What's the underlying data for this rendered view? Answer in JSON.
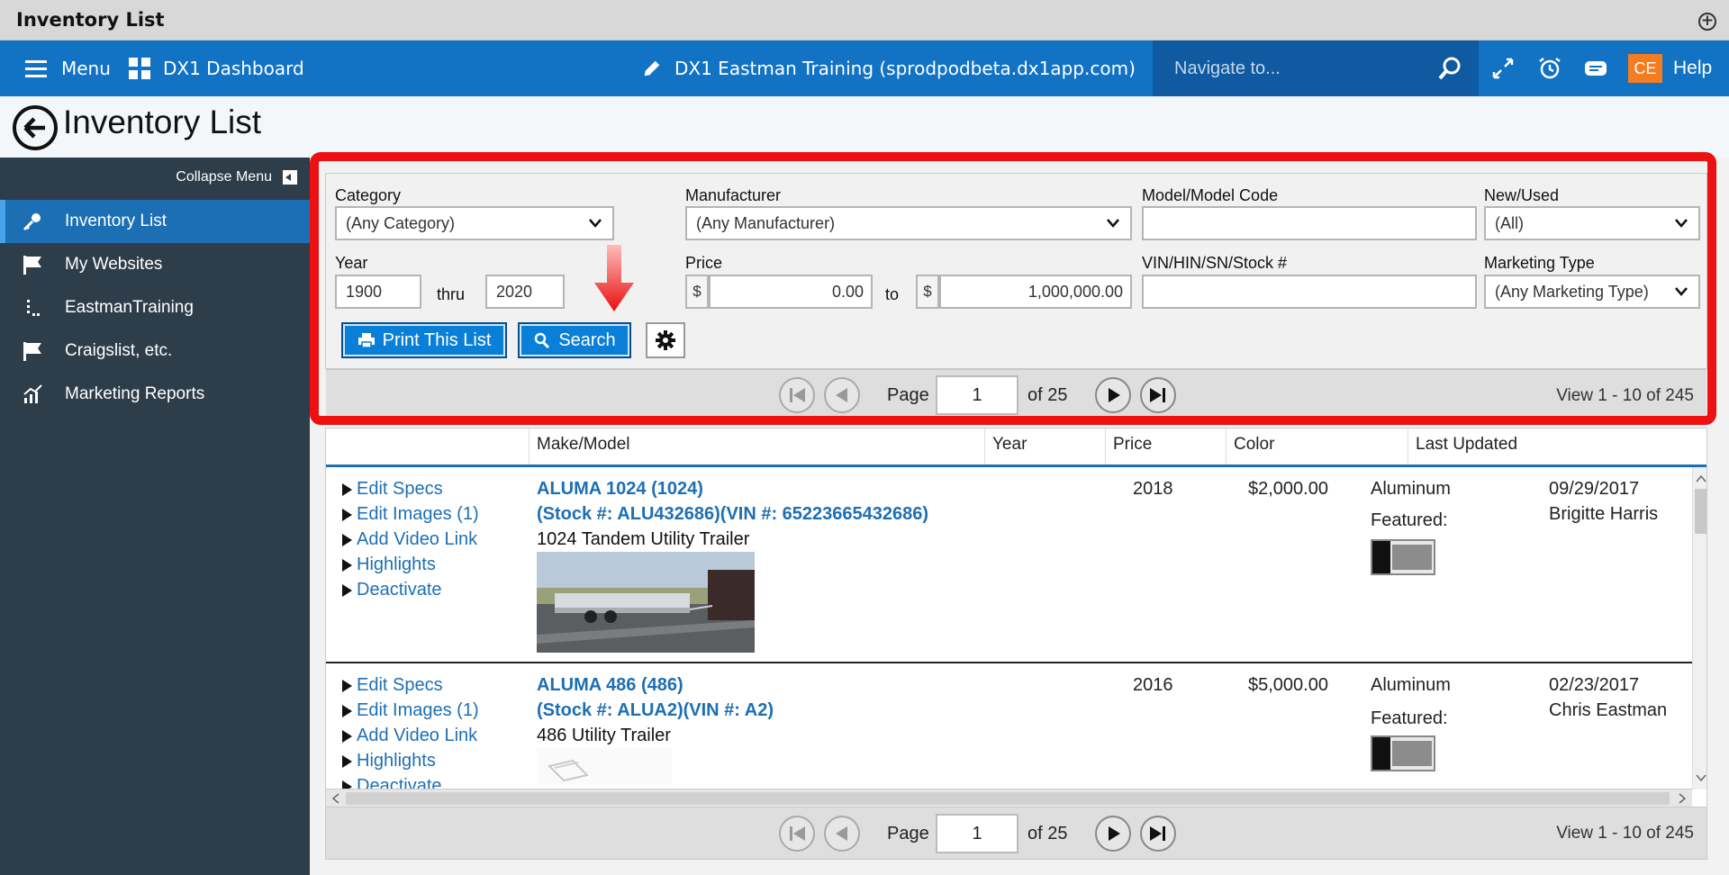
{
  "window": {
    "title": "Inventory List"
  },
  "topbar": {
    "menu_label": "Menu",
    "dashboard_label": "DX1 Dashboard",
    "site_label": "DX1 Eastman Training (sprodpodbeta.dx1app.com)",
    "navigate_placeholder": "Navigate to...",
    "avatar_initials": "CE",
    "help_label": "Help",
    "accent_color": "#1272c4"
  },
  "page": {
    "title": "Inventory List"
  },
  "sidebar": {
    "collapse_label": "Collapse Menu",
    "items": [
      {
        "label": "Inventory List",
        "icon": "key-icon",
        "active": true
      },
      {
        "label": "My Websites",
        "icon": "flag-icon"
      },
      {
        "label": "EastmanTraining",
        "icon": "dots-icon"
      },
      {
        "label": "Craigslist, etc.",
        "icon": "flag-icon"
      },
      {
        "label": "Marketing Reports",
        "icon": "chart-icon"
      }
    ]
  },
  "filters": {
    "category_label": "Category",
    "category_value": "(Any Category)",
    "manufacturer_label": "Manufacturer",
    "manufacturer_value": "(Any Manufacturer)",
    "model_label": "Model/Model Code",
    "model_value": "",
    "newused_label": "New/Used",
    "newused_value": "(All)",
    "year_label": "Year",
    "year_from": "1900",
    "year_thru_label": "thru",
    "year_to": "2020",
    "price_label": "Price",
    "currency_symbol": "$",
    "price_from": "0.00",
    "price_to_label": "to",
    "price_to": "1,000,000.00",
    "vin_label": "VIN/HIN/SN/Stock #",
    "vin_value": "",
    "marketing_label": "Marketing Type",
    "marketing_value": "(Any Marketing Type)",
    "print_label": "Print This List",
    "search_label": "Search"
  },
  "pager": {
    "page_label": "Page",
    "current_page": "1",
    "of_label": "of 25",
    "view_text": "View 1 - 10 of 245"
  },
  "table": {
    "columns": [
      "Make/Model",
      "Year",
      "Price",
      "Color",
      "Last Updated"
    ],
    "actions": [
      "Edit Specs",
      "Edit Images (1)",
      "Add Video Link",
      "Highlights",
      "Deactivate"
    ],
    "featured_label": "Featured:",
    "rows": [
      {
        "title": "ALUMA 1024 (1024)",
        "stock": "(Stock #: ALU432686)(VIN #: 65223665432686)",
        "desc": "1024 Tandem Utility Trailer",
        "year": "2018",
        "price": "$2,000.00",
        "color": "Aluminum",
        "updated_date": "09/29/2017",
        "updated_by": "Brigitte Harris"
      },
      {
        "title": "ALUMA 486 (486)",
        "stock": "(Stock #: ALUA2)(VIN #: A2)",
        "desc": "486 Utility Trailer",
        "year": "2016",
        "price": "$5,000.00",
        "color": "Aluminum",
        "updated_date": "02/23/2017",
        "updated_by": "Chris Eastman"
      }
    ]
  },
  "highlight_color": "#ee1111"
}
